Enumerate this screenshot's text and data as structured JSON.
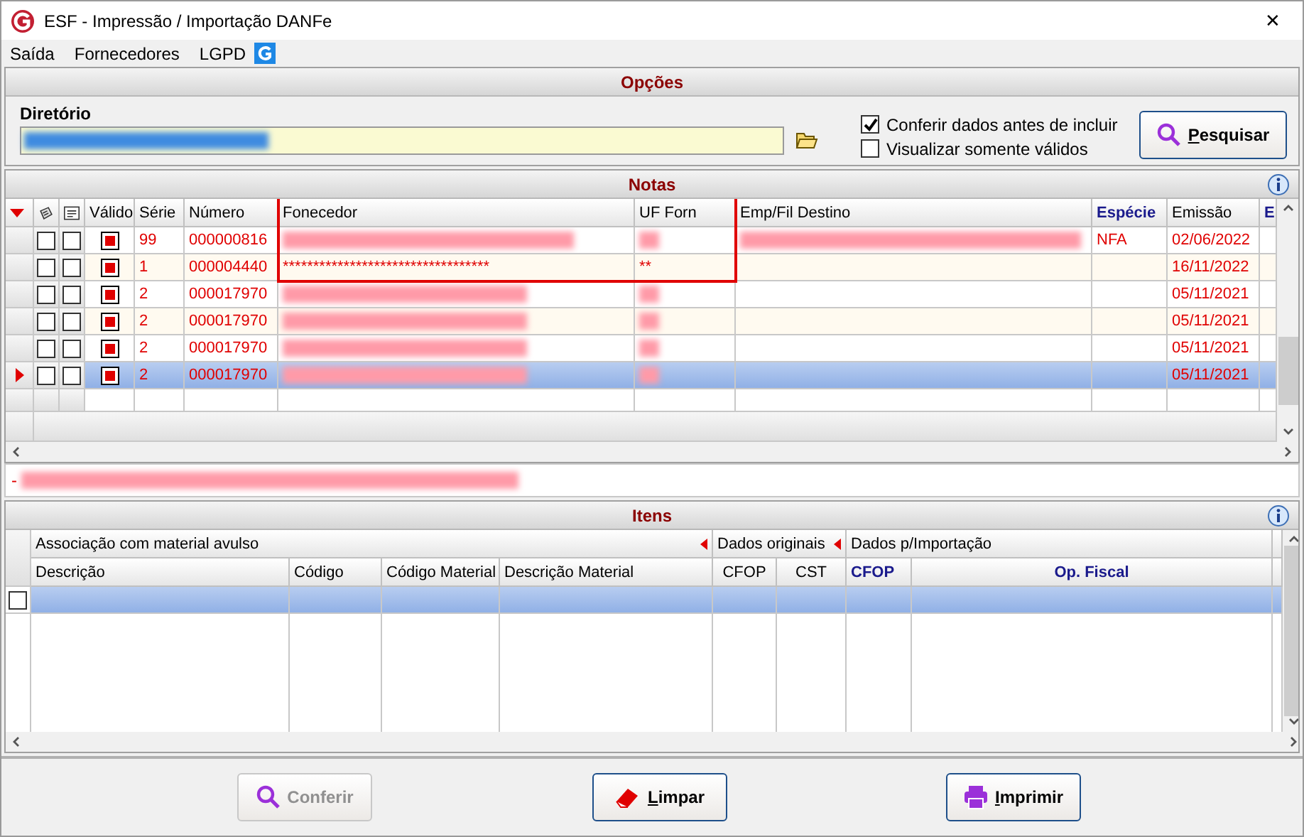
{
  "window": {
    "title": "ESF - Impressão / Importação DANFe",
    "close": "✕"
  },
  "menu": [
    "Saída",
    "Fornecedores",
    "LGPD"
  ],
  "options": {
    "title": "Opções",
    "directory_label": "Diretório",
    "checks": [
      {
        "label": "Conferir dados antes de incluir",
        "checked": true
      },
      {
        "label": "Visualizar somente válidos",
        "checked": false
      }
    ],
    "search_button": "Pesquisar"
  },
  "notas": {
    "title": "Notas",
    "columns": [
      {
        "label": "Válido",
        "kind": "normal"
      },
      {
        "label": "Série",
        "kind": "normal"
      },
      {
        "label": "Número",
        "kind": "normal"
      },
      {
        "label": "Fonecedor",
        "kind": "normal"
      },
      {
        "label": "UF Forn",
        "kind": "normal"
      },
      {
        "label": "Emp/Fil Destino",
        "kind": "normal"
      },
      {
        "label": "Espécie",
        "kind": "bold"
      },
      {
        "label": "Emissão",
        "kind": "normal"
      },
      {
        "label": "E",
        "kind": "bold"
      }
    ],
    "rows": [
      {
        "selected": false,
        "checked_a": false,
        "checked_b": false,
        "valid": true,
        "serie": "99",
        "numero": "000000816",
        "fornecedor": {
          "kind": "redacted"
        },
        "uf": {
          "kind": "redacted"
        },
        "destino": {
          "kind": "redacted"
        },
        "especie": "NFA",
        "emissao": "02/06/2022"
      },
      {
        "selected": false,
        "checked_a": false,
        "checked_b": false,
        "valid": true,
        "serie": "1",
        "numero": "000004440",
        "fornecedor": {
          "kind": "text",
          "text": "**********************************"
        },
        "uf": {
          "kind": "text",
          "text": "**"
        },
        "destino": {
          "kind": "empty"
        },
        "emissao": "16/11/2022"
      },
      {
        "selected": false,
        "checked_a": false,
        "checked_b": false,
        "valid": true,
        "serie": "2",
        "numero": "000017970",
        "fornecedor": {
          "kind": "redacted"
        },
        "uf": {
          "kind": "redacted"
        },
        "destino": {
          "kind": "empty"
        },
        "emissao": "05/11/2021"
      },
      {
        "selected": false,
        "checked_a": false,
        "checked_b": false,
        "valid": true,
        "serie": "2",
        "numero": "000017970",
        "fornecedor": {
          "kind": "redacted"
        },
        "uf": {
          "kind": "redacted"
        },
        "destino": {
          "kind": "empty"
        },
        "emissao": "05/11/2021"
      },
      {
        "selected": false,
        "checked_a": false,
        "checked_b": false,
        "valid": true,
        "serie": "2",
        "numero": "000017970",
        "fornecedor": {
          "kind": "redacted"
        },
        "uf": {
          "kind": "redacted"
        },
        "destino": {
          "kind": "empty"
        },
        "emissao": "05/11/2021"
      },
      {
        "selected": true,
        "checked_a": false,
        "checked_b": false,
        "valid": true,
        "serie": "2",
        "numero": "000017970",
        "fornecedor": {
          "kind": "redacted"
        },
        "uf": {
          "kind": "redacted"
        },
        "destino": {
          "kind": "empty"
        },
        "emissao": "05/11/2021"
      }
    ],
    "message": {
      "prefix": "-"
    }
  },
  "itens": {
    "title": "Itens",
    "groups": [
      {
        "label": "Associação com material avulso"
      },
      {
        "label": "Dados originais"
      },
      {
        "label": "Dados p/Importação"
      }
    ],
    "columns": [
      {
        "label": "Descrição",
        "kind": "normal"
      },
      {
        "label": "Código",
        "kind": "normal"
      },
      {
        "label": "Código Material",
        "kind": "normal"
      },
      {
        "label": "Descrição Material",
        "kind": "normal"
      },
      {
        "label": "CFOP",
        "kind": "center"
      },
      {
        "label": "CST",
        "kind": "center"
      },
      {
        "label": "CFOP",
        "kind": "bold"
      },
      {
        "label": "Op. Fiscal",
        "kind": "bold"
      }
    ],
    "rows": [
      {
        "checked": false,
        "selected": true
      }
    ]
  },
  "buttons": [
    {
      "label": "Conferir",
      "disabled": true
    },
    {
      "label": "Limpar",
      "disabled": false
    },
    {
      "label": "Imprimir",
      "disabled": false
    }
  ]
}
